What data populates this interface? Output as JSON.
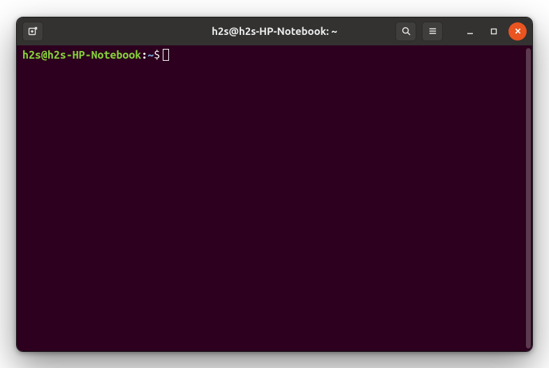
{
  "window": {
    "title": "h2s@h2s-HP-Notebook: ~"
  },
  "titlebar": {
    "new_tab_tooltip": "New Tab",
    "search_tooltip": "Search",
    "menu_tooltip": "Menu",
    "minimize_tooltip": "Minimize",
    "maximize_tooltip": "Maximize",
    "close_tooltip": "Close"
  },
  "terminal": {
    "prompt_user_host": "h2s@h2s-HP-Notebook",
    "prompt_separator": ":",
    "prompt_path": "~",
    "prompt_symbol": "$",
    "input_value": ""
  },
  "colors": {
    "titlebar_bg": "#333231",
    "terminal_bg": "#2c001e",
    "prompt_user": "#87d13a",
    "prompt_path": "#6f9fcf",
    "close_btn": "#e95420"
  }
}
